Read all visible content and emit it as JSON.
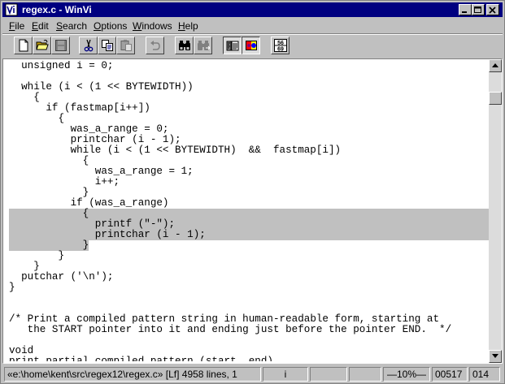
{
  "window": {
    "title": "regex.c - WinVi"
  },
  "menu": [
    {
      "label": "File",
      "accel": "F",
      "rest": "ile"
    },
    {
      "label": "Edit",
      "accel": "E",
      "rest": "dit"
    },
    {
      "label": "Search",
      "accel": "S",
      "rest": "earch"
    },
    {
      "label": "Options",
      "accel": "O",
      "rest": "ptions"
    },
    {
      "label": "Windows",
      "accel": "W",
      "rest": "indows"
    },
    {
      "label": "Help",
      "accel": "H",
      "rest": "elp"
    }
  ],
  "toolbar": {
    "number_icon_top": "56",
    "number_icon_bottom": "69"
  },
  "editor": {
    "lines": [
      "unsigned i = 0;",
      "",
      "while (i < (1 << BYTEWIDTH))",
      "  {",
      "    if (fastmap[i++])",
      "      {",
      "        was_a_range = 0;",
      "        printchar (i - 1);",
      "        while (i < (1 << BYTEWIDTH)  &&  fastmap[i])",
      "          {",
      "            was_a_range = 1;",
      "            i++;",
      "          }",
      "        if (was_a_range)",
      "          {",
      "            printf (\"-\");",
      "            printchar (i - 1);",
      "          }",
      "      }",
      "  }",
      "putchar ('\\n');",
      "}",
      "",
      "",
      "/* Print a compiled pattern string in human-readable form, starting at",
      "   the START pointer into it and ending just before the pointer END.  */",
      "",
      "void",
      "print_partial_compiled_pattern (start, end)"
    ]
  },
  "status": {
    "file_info": "«e:\\home\\kent\\src\\regex12\\regex.c» [Lf] 4958 lines, 1",
    "mode": "i",
    "percent": "—10%—",
    "line": "00517",
    "col": "014"
  }
}
